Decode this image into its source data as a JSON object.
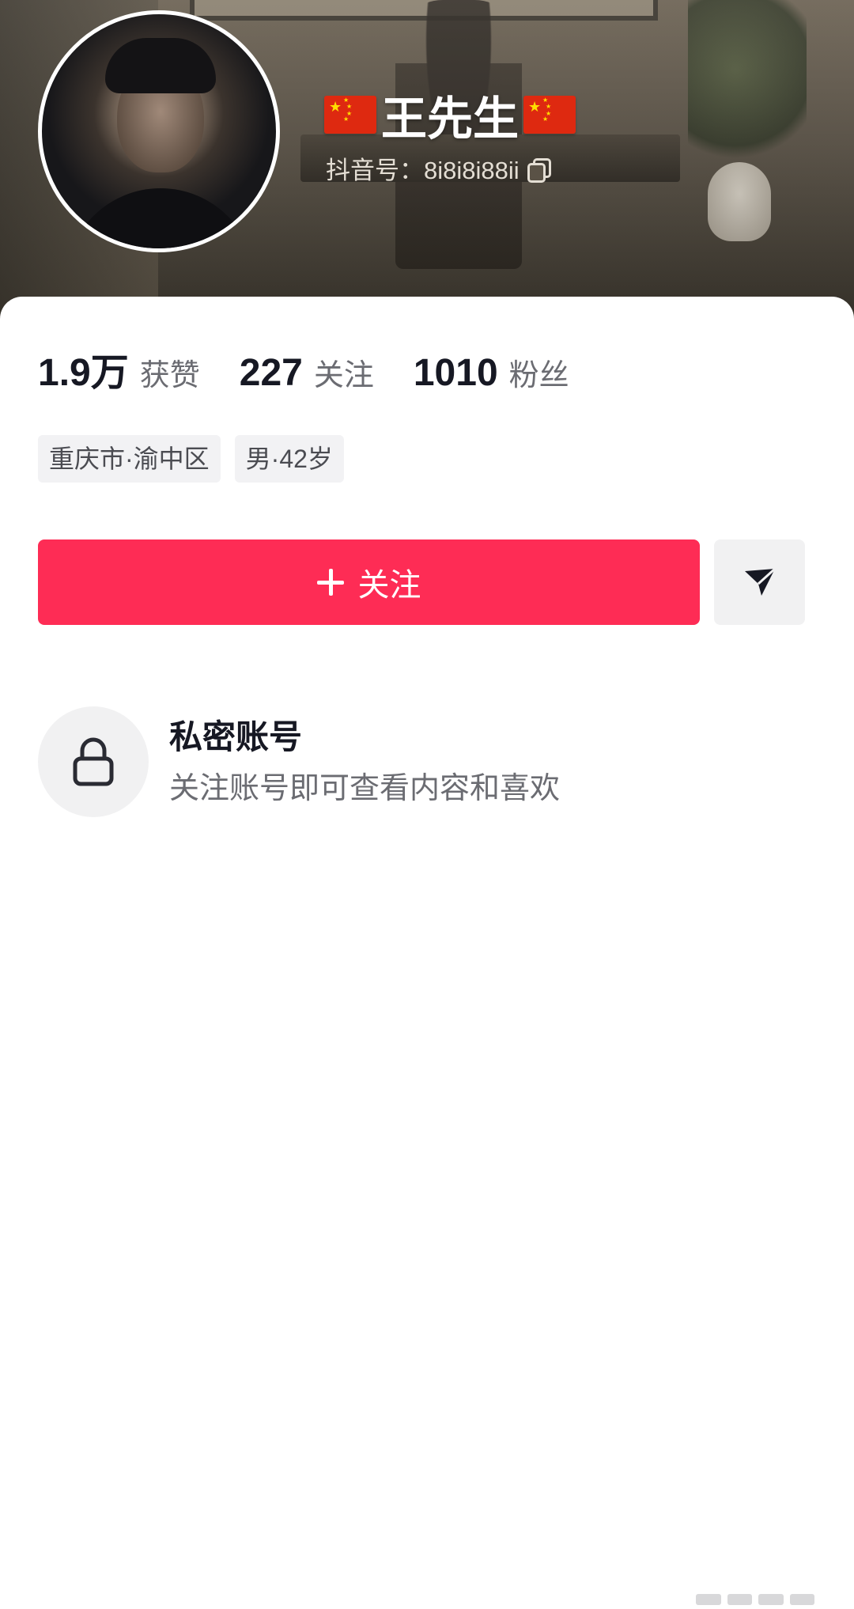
{
  "profile": {
    "name": "王先生",
    "douyin_id": "抖音号：8i8i8i88ii"
  },
  "stats": [
    {
      "value": "1.9万",
      "label": "获赞"
    },
    {
      "value": "227",
      "label": "关注"
    },
    {
      "value": "1010",
      "label": "粉丝"
    }
  ],
  "tags": [
    "重庆市·渝中区",
    "男·42岁"
  ],
  "actions": {
    "follow_label": "关注",
    "message_icon": "send-icon"
  },
  "private_notice": {
    "title": "私密账号",
    "description": "关注账号即可查看内容和喜欢",
    "icon": "lock-icon"
  },
  "colors": {
    "accent": "#fe2c55",
    "text_primary": "#161823",
    "text_secondary": "#6b6c72"
  }
}
